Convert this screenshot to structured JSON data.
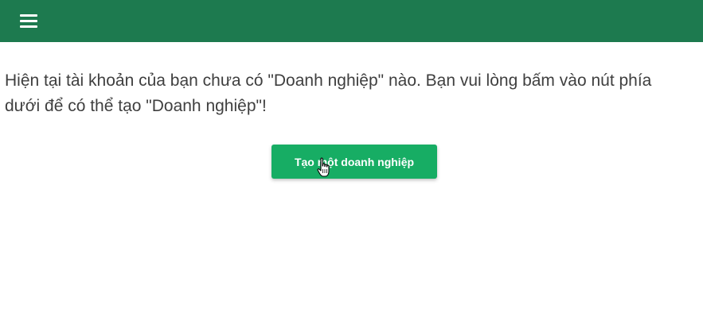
{
  "header": {
    "menu_icon": "hamburger-menu-icon",
    "background_color": "#1d7a4f"
  },
  "main": {
    "message": "Hiện tại tài khoản của bạn chưa có \"Doanh nghiệp\" nào. Bạn vui lòng bấm vào nút phía dưới để có thể tạo \"Doanh nghiệp\"!",
    "create_button_label": "Tạo một doanh nghiệp",
    "button_color": "#17ad64"
  },
  "cursor": {
    "icon": "hand-pointer-cursor-icon"
  }
}
